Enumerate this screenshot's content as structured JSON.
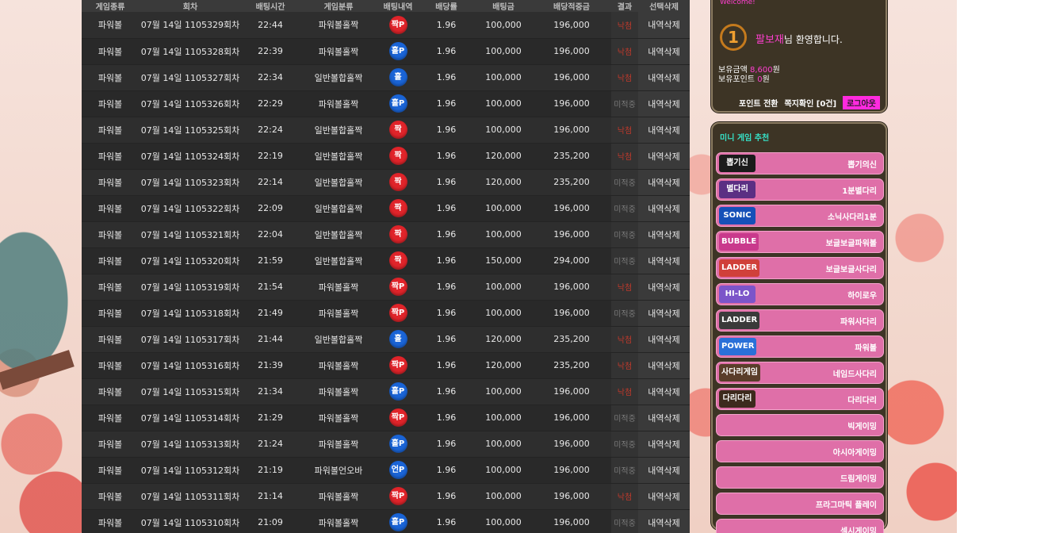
{
  "table": {
    "headers": [
      "게임종류",
      "회차",
      "배팅시간",
      "게임분류",
      "배팅내역",
      "배당률",
      "배팅금",
      "배당적중금",
      "결과",
      "선택삭제"
    ],
    "rows": [
      {
        "game": "파워볼",
        "round": "07월 14일 1105329회차",
        "time": "22:44",
        "type": "파워볼홀짝",
        "pick": "짝P",
        "pick_color": "red",
        "odds": "1.96",
        "bet": "100,000",
        "payout": "196,000",
        "result": "낙첨",
        "result_state": "loss",
        "action": "내역삭제"
      },
      {
        "game": "파워볼",
        "round": "07월 14일 1105328회차",
        "time": "22:39",
        "type": "파워볼홀짝",
        "pick": "홀P",
        "pick_color": "blue",
        "odds": "1.96",
        "bet": "100,000",
        "payout": "196,000",
        "result": "낙첨",
        "result_state": "loss",
        "action": "내역삭제"
      },
      {
        "game": "파워볼",
        "round": "07월 14일 1105327회차",
        "time": "22:34",
        "type": "일반볼합홀짝",
        "pick": "홀",
        "pick_color": "blue",
        "odds": "1.96",
        "bet": "100,000",
        "payout": "196,000",
        "result": "낙첨",
        "result_state": "loss",
        "action": "내역삭제"
      },
      {
        "game": "파워볼",
        "round": "07월 14일 1105326회차",
        "time": "22:29",
        "type": "파워볼홀짝",
        "pick": "홀P",
        "pick_color": "blue",
        "odds": "1.96",
        "bet": "100,000",
        "payout": "196,000",
        "result": "미적중",
        "result_state": "pending",
        "action": "내역삭제"
      },
      {
        "game": "파워볼",
        "round": "07월 14일 1105325회차",
        "time": "22:24",
        "type": "일반볼합홀짝",
        "pick": "짝",
        "pick_color": "red",
        "odds": "1.96",
        "bet": "100,000",
        "payout": "196,000",
        "result": "낙첨",
        "result_state": "loss",
        "action": "내역삭제"
      },
      {
        "game": "파워볼",
        "round": "07월 14일 1105324회차",
        "time": "22:19",
        "type": "일반볼합홀짝",
        "pick": "짝",
        "pick_color": "red",
        "odds": "1.96",
        "bet": "120,000",
        "payout": "235,200",
        "result": "낙첨",
        "result_state": "loss",
        "action": "내역삭제"
      },
      {
        "game": "파워볼",
        "round": "07월 14일 1105323회차",
        "time": "22:14",
        "type": "일반볼합홀짝",
        "pick": "짝",
        "pick_color": "red",
        "odds": "1.96",
        "bet": "120,000",
        "payout": "235,200",
        "result": "미적중",
        "result_state": "pending",
        "action": "내역삭제"
      },
      {
        "game": "파워볼",
        "round": "07월 14일 1105322회차",
        "time": "22:09",
        "type": "일반볼합홀짝",
        "pick": "짝",
        "pick_color": "red",
        "odds": "1.96",
        "bet": "100,000",
        "payout": "196,000",
        "result": "미적중",
        "result_state": "pending",
        "action": "내역삭제"
      },
      {
        "game": "파워볼",
        "round": "07월 14일 1105321회차",
        "time": "22:04",
        "type": "일반볼합홀짝",
        "pick": "짝",
        "pick_color": "red",
        "odds": "1.96",
        "bet": "100,000",
        "payout": "196,000",
        "result": "미적중",
        "result_state": "pending",
        "action": "내역삭제"
      },
      {
        "game": "파워볼",
        "round": "07월 14일 1105320회차",
        "time": "21:59",
        "type": "일반볼합홀짝",
        "pick": "짝",
        "pick_color": "red",
        "odds": "1.96",
        "bet": "150,000",
        "payout": "294,000",
        "result": "미적중",
        "result_state": "pending",
        "action": "내역삭제"
      },
      {
        "game": "파워볼",
        "round": "07월 14일 1105319회차",
        "time": "21:54",
        "type": "파워볼홀짝",
        "pick": "짝P",
        "pick_color": "red",
        "odds": "1.96",
        "bet": "100,000",
        "payout": "196,000",
        "result": "낙첨",
        "result_state": "loss",
        "action": "내역삭제"
      },
      {
        "game": "파워볼",
        "round": "07월 14일 1105318회차",
        "time": "21:49",
        "type": "파워볼홀짝",
        "pick": "짝P",
        "pick_color": "red",
        "odds": "1.96",
        "bet": "100,000",
        "payout": "196,000",
        "result": "미적중",
        "result_state": "pending",
        "action": "내역삭제"
      },
      {
        "game": "파워볼",
        "round": "07월 14일 1105317회차",
        "time": "21:44",
        "type": "일반볼합홀짝",
        "pick": "홀",
        "pick_color": "blue",
        "odds": "1.96",
        "bet": "120,000",
        "payout": "235,200",
        "result": "낙첨",
        "result_state": "loss",
        "action": "내역삭제"
      },
      {
        "game": "파워볼",
        "round": "07월 14일 1105316회차",
        "time": "21:39",
        "type": "파워볼홀짝",
        "pick": "짝P",
        "pick_color": "red",
        "odds": "1.96",
        "bet": "120,000",
        "payout": "235,200",
        "result": "낙첨",
        "result_state": "loss",
        "action": "내역삭제"
      },
      {
        "game": "파워볼",
        "round": "07월 14일 1105315회차",
        "time": "21:34",
        "type": "파워볼홀짝",
        "pick": "홀P",
        "pick_color": "blue",
        "odds": "1.96",
        "bet": "100,000",
        "payout": "196,000",
        "result": "낙첨",
        "result_state": "loss",
        "action": "내역삭제"
      },
      {
        "game": "파워볼",
        "round": "07월 14일 1105314회차",
        "time": "21:29",
        "type": "파워볼홀짝",
        "pick": "짝P",
        "pick_color": "red",
        "odds": "1.96",
        "bet": "100,000",
        "payout": "196,000",
        "result": "미적중",
        "result_state": "pending",
        "action": "내역삭제"
      },
      {
        "game": "파워볼",
        "round": "07월 14일 1105313회차",
        "time": "21:24",
        "type": "파워볼홀짝",
        "pick": "홀P",
        "pick_color": "blue",
        "odds": "1.96",
        "bet": "100,000",
        "payout": "196,000",
        "result": "미적중",
        "result_state": "pending",
        "action": "내역삭제"
      },
      {
        "game": "파워볼",
        "round": "07월 14일 1105312회차",
        "time": "21:19",
        "type": "파워볼언오바",
        "pick": "언P",
        "pick_color": "blue",
        "odds": "1.96",
        "bet": "100,000",
        "payout": "196,000",
        "result": "미적중",
        "result_state": "pending",
        "action": "내역삭제"
      },
      {
        "game": "파워볼",
        "round": "07월 14일 1105311회차",
        "time": "21:14",
        "type": "파워볼홀짝",
        "pick": "짝P",
        "pick_color": "red",
        "odds": "1.96",
        "bet": "100,000",
        "payout": "196,000",
        "result": "낙첨",
        "result_state": "loss",
        "action": "내역삭제"
      },
      {
        "game": "파워볼",
        "round": "07월 14일 1105310회차",
        "time": "21:09",
        "type": "파워볼홀짝",
        "pick": "홀P",
        "pick_color": "blue",
        "odds": "1.96",
        "bet": "100,000",
        "payout": "196,000",
        "result": "미적중",
        "result_state": "pending",
        "action": "내역삭제"
      }
    ]
  },
  "user_panel": {
    "welcome_small": "Welcome!",
    "level": "1",
    "username": "팔보재",
    "welcome_suffix": "님 환영합니다.",
    "money_label": "보유금액",
    "money_value": "8,600",
    "money_unit": "원",
    "point_label": "보유포인트",
    "point_value": "0",
    "point_unit": "원",
    "point_convert_label": "포인트 전환",
    "message_label": "쪽지확인 [0건]",
    "logout_label": "로그아웃"
  },
  "games_panel": {
    "title": "미니 게임 추천",
    "items": [
      {
        "label": "뽑기의신",
        "logo_text": "뽑기신",
        "logo_color": "#1b1b1b"
      },
      {
        "label": "1분별다리",
        "logo_text": "별다리",
        "logo_color": "#5b2f83"
      },
      {
        "label": "소닉사다리1분",
        "logo_text": "SONIC",
        "logo_color": "#1650b8"
      },
      {
        "label": "보글보글파워볼",
        "logo_text": "BUBBLE",
        "logo_color": "#c9398c"
      },
      {
        "label": "보글보글사다리",
        "logo_text": "LADDER",
        "logo_color": "#d0403a"
      },
      {
        "label": "하이로우",
        "logo_text": "HI-LO",
        "logo_color": "#7c55c9"
      },
      {
        "label": "파워사다리",
        "logo_text": "LADDER",
        "logo_color": "#3a3a3a"
      },
      {
        "label": "파워볼",
        "logo_text": "POWER",
        "logo_color": "#2a70d8"
      },
      {
        "label": "네임드사다리",
        "logo_text": "사다리게임",
        "logo_color": "#5a3d2a"
      },
      {
        "label": "다리다리",
        "logo_text": "다리다리",
        "logo_color": "#3d2a1d"
      },
      {
        "label": "빅게이밍",
        "logo_text": "",
        "logo_color": ""
      },
      {
        "label": "아시아게이밍",
        "logo_text": "",
        "logo_color": ""
      },
      {
        "label": "드림게이밍",
        "logo_text": "",
        "logo_color": ""
      },
      {
        "label": "프라그마틱 플레이",
        "logo_text": "",
        "logo_color": ""
      },
      {
        "label": "섹시게이밍",
        "logo_text": "",
        "logo_color": ""
      }
    ]
  },
  "colors": {
    "table_bg": "#2b2b2b",
    "red_ball": "#e0242a",
    "blue_ball": "#1a64d6",
    "loss_text": "#c0392b",
    "pending_text": "#7a7a7a",
    "accent_pink": "#ff3fd0",
    "game_item_pink": "#df6fa8",
    "panel_title_cyan": "#36e2c8"
  }
}
